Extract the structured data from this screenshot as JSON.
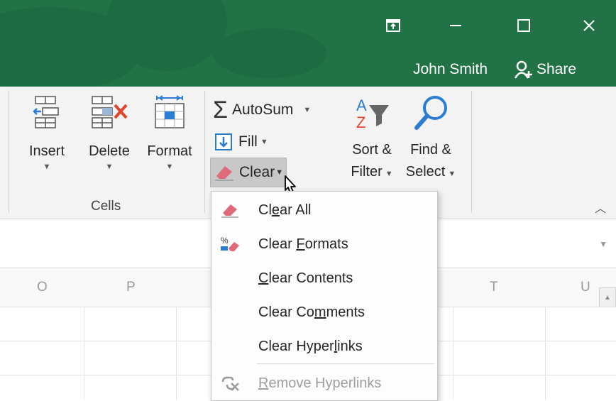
{
  "titlebar": {
    "user_name": "John Smith",
    "share_label": "Share",
    "icons": [
      "ribbon-display-options-icon",
      "minimize-icon",
      "maximize-icon",
      "close-icon",
      "share-person-icon"
    ]
  },
  "ribbon": {
    "cells_group": {
      "label": "Cells",
      "insert_label": "Insert",
      "delete_label": "Delete",
      "format_label": "Format"
    },
    "editing": {
      "autosum_label": "AutoSum",
      "fill_label": "Fill",
      "clear_label": "Clear",
      "sort_filter_line1": "Sort &",
      "sort_filter_line2": "Filter",
      "find_select_line1": "Find &",
      "find_select_line2": "Select"
    }
  },
  "grid": {
    "columns": [
      "O",
      "P",
      "T",
      "U"
    ]
  },
  "clear_menu": {
    "items": [
      {
        "pre": "Cl",
        "key": "e",
        "post": "ar All",
        "icon": "eraser-icon"
      },
      {
        "pre": "Clear ",
        "key": "F",
        "post": "ormats",
        "icon": "clear-formats-icon"
      },
      {
        "pre": "",
        "key": "C",
        "post": "lear Contents",
        "icon": ""
      },
      {
        "pre": "Clear Co",
        "key": "m",
        "post": "ments",
        "icon": ""
      },
      {
        "pre": "Clear Hyper",
        "key": "l",
        "post": "inks",
        "icon": ""
      },
      {
        "pre": "",
        "key": "R",
        "post": "emove Hyperlinks",
        "icon": "remove-hyperlink-icon",
        "disabled": true
      }
    ]
  },
  "colors": {
    "title_green": "#217346",
    "ribbon_bg": "#f3f3f3",
    "eraser_pink": "#e06a7a",
    "accent_blue": "#2b7cd3"
  }
}
